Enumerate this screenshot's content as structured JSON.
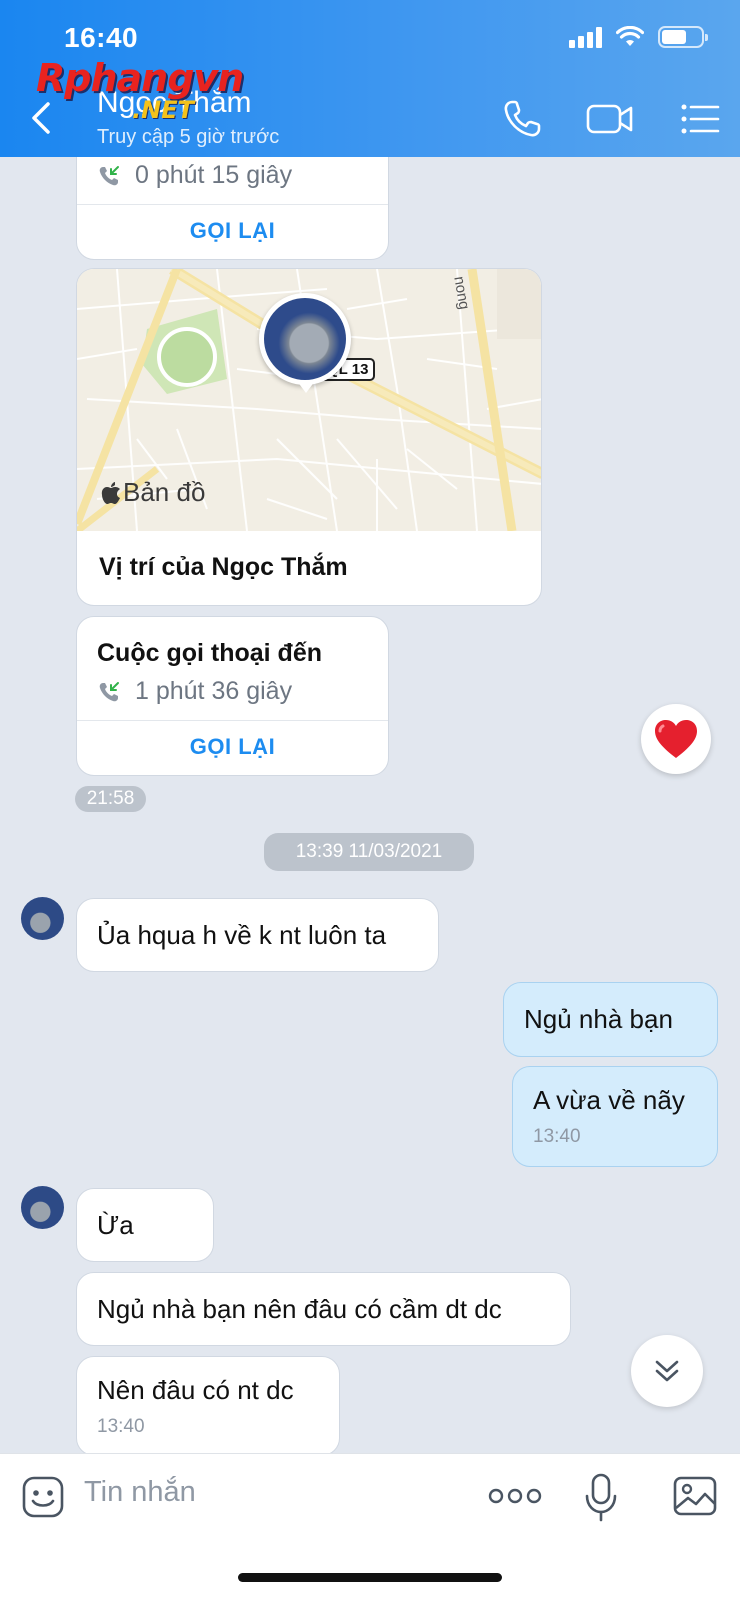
{
  "status_bar": {
    "time": "16:40"
  },
  "header": {
    "contact_name": "Ngọc Thắm",
    "last_seen": "Truy cập 5 giờ trước"
  },
  "watermark": {
    "brand": "Rphangvn",
    "suffix": ".NET"
  },
  "messages": {
    "call_1": {
      "duration": "0 phút 15 giây",
      "callback_label": "GỌI LẠI"
    },
    "location": {
      "map_badge": "QL 13",
      "map_road": "nong",
      "map_provider": "Bản đồ",
      "label": "Vị trí của Ngọc Thắm"
    },
    "call_2": {
      "title": "Cuộc gọi thoại đến",
      "duration": "1 phút 36 giây",
      "callback_label": "GỌI LẠI"
    },
    "time_2158": "21:58",
    "date_separator": "13:39 11/03/2021",
    "msg_1": "Ủa hqua h về k nt luôn ta",
    "msg_2": "Ngủ nhà bạn",
    "msg_3": {
      "text": "A vừa về nãy",
      "time": "13:40"
    },
    "msg_4": "Ừa",
    "msg_5": "Ngủ nhà bạn nên đâu có cầm dt dc",
    "msg_6": {
      "text": "Nên đâu có nt dc",
      "time": "13:40"
    }
  },
  "input": {
    "placeholder": "Tin nhắn"
  },
  "colors": {
    "header_blue": "#1a86f0",
    "my_bubble": "#d4ecfc",
    "link_blue": "#1d8cf0",
    "chat_bg": "#e2e7ef",
    "heart_red": "#e5202e"
  },
  "icons": [
    "back-icon",
    "phone-icon",
    "video-call-icon",
    "menu-icon",
    "heart-icon",
    "scroll-down-icon",
    "sticker-icon",
    "more-icon",
    "microphone-icon",
    "image-icon"
  ]
}
